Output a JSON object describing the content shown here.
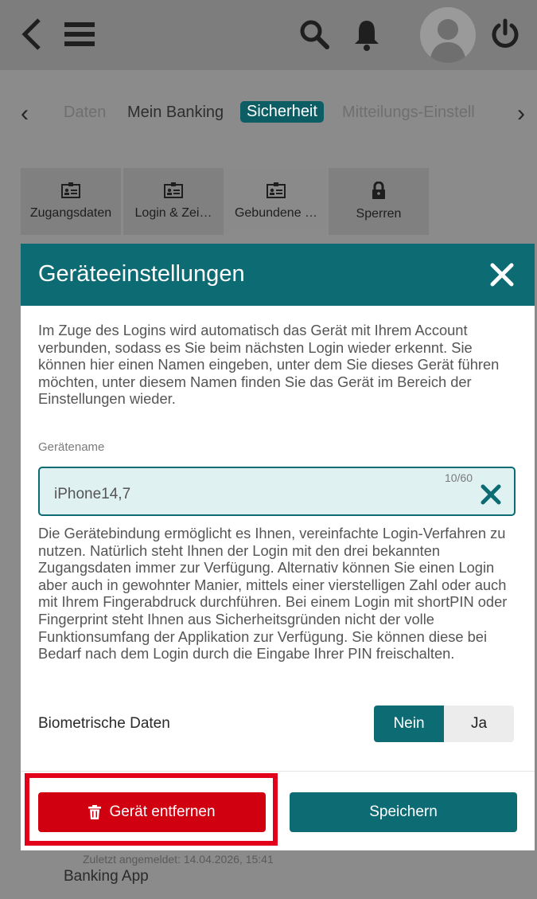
{
  "topbar": {
    "icons": [
      "back-icon",
      "menu-icon",
      "search-icon",
      "bell-icon",
      "avatar",
      "power-icon"
    ]
  },
  "tabs": {
    "items": [
      {
        "label": "Daten",
        "state": "faded"
      },
      {
        "label": "Mein Banking",
        "state": "normal"
      },
      {
        "label": "Sicherheit",
        "state": "active"
      },
      {
        "label": "Mitteilungs-Einstell",
        "state": "faded"
      }
    ]
  },
  "subtabs": {
    "items": [
      {
        "label": "Zugangsdaten",
        "icon": "id-card-icon"
      },
      {
        "label": "Login & Zei…",
        "icon": "id-card-icon"
      },
      {
        "label": "Gebundene …",
        "icon": "id-card-icon"
      },
      {
        "label": "Sperren",
        "icon": "lock-icon"
      }
    ]
  },
  "background_list": {
    "last_login": "Zuletzt angemeldet: 14.04.2026, 15:41",
    "device": "Banking App"
  },
  "modal": {
    "title": "Geräteeinstellungen",
    "intro": "Im Zuge des Logins wird automatisch das Gerät mit Ihrem Account verbunden, sodass es Sie beim nächsten Login wieder erkennt. Sie können hier einen Namen eingeben, unter dem Sie dieses Gerät führen möchten, unter diesem Namen finden Sie das Gerät im Bereich der Einstellungen wieder.",
    "field_label": "Gerätename",
    "field_value": "iPhone14,7",
    "field_counter": "10/60",
    "body": "Die Gerätebindung ermöglicht es Ihnen, vereinfachte Login-Verfahren zu nutzen. Natürlich steht Ihnen der Login mit den drei bekannten Zugangsdaten immer zur Verfügung. Alternativ können Sie einen Login aber auch in gewohnter Manier, mittels einer vierstelligen Zahl oder auch mit Ihrem Fingerabdruck durchführen. Bei einem Login mit shortPIN oder Fingerprint steht Ihnen aus Sicherheitsgründen nicht der volle Funktionsumfang der Applikation zur Verfügung. Sie können diese bei Bedarf nach dem Login durch die Eingabe Ihrer PIN freischalten.",
    "biometric_label": "Biometrische Daten",
    "toggle": {
      "no": "Nein",
      "yes": "Ja",
      "selected": "Nein"
    },
    "delete_label": "Gerät entfernen",
    "save_label": "Speichern"
  },
  "colors": {
    "accent": "#0d6b73",
    "danger": "#d10010",
    "highlight": "#e3001b"
  }
}
